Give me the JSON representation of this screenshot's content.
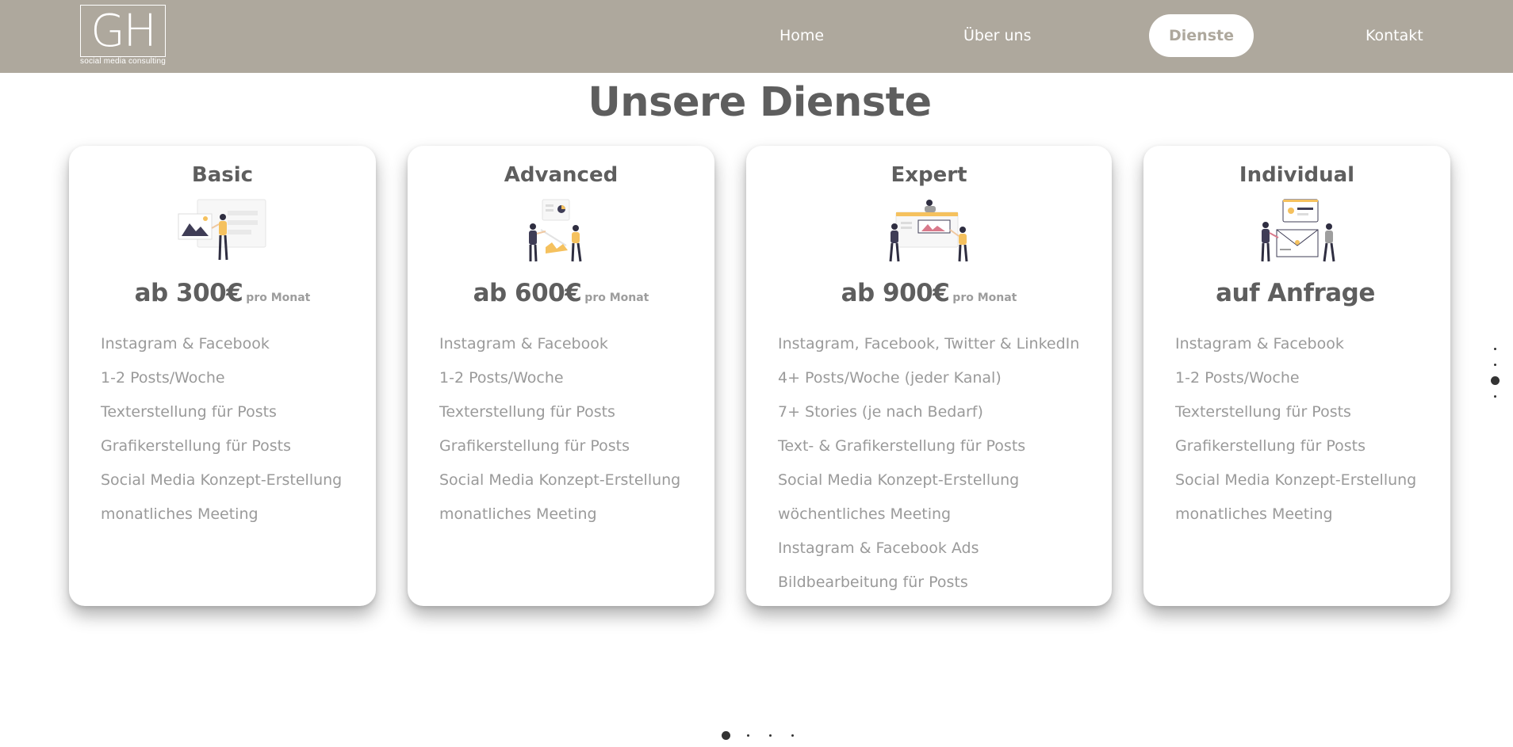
{
  "brand": {
    "logo_letters": "GH",
    "logo_subtitle": "social media consulting"
  },
  "nav": {
    "items": [
      {
        "label": "Home",
        "active": false
      },
      {
        "label": "Über uns",
        "active": false
      },
      {
        "label": "Dienste",
        "active": true
      },
      {
        "label": "Kontakt",
        "active": false
      }
    ]
  },
  "page": {
    "title": "Unsere Dienste"
  },
  "cards": [
    {
      "title": "Basic",
      "price": "ab 300€",
      "per": "pro Monat",
      "features": [
        "Instagram & Facebook",
        "1-2 Posts/Woche",
        "Texterstellung für Posts",
        "Grafikerstellung für Posts",
        "Social Media Konzept-Erstellung",
        "monatliches Meeting"
      ]
    },
    {
      "title": "Advanced",
      "price": "ab 600€",
      "per": "pro Monat",
      "features": [
        "Instagram & Facebook",
        "1-2 Posts/Woche",
        "Texterstellung für Posts",
        "Grafikerstellung für Posts",
        "Social Media Konzept-Erstellung",
        "monatliches Meeting"
      ]
    },
    {
      "title": "Expert",
      "price": "ab 900€",
      "per": "pro Monat",
      "features": [
        "Instagram, Facebook, Twitter & LinkedIn",
        "4+ Posts/Woche (jeder Kanal)",
        "7+ Stories (je nach Bedarf)",
        "Text- & Grafikerstellung für Posts",
        "Social Media Konzept-Erstellung",
        "wöchentliches Meeting",
        "Instagram & Facebook Ads",
        "Bildbearbeitung für Posts"
      ]
    },
    {
      "title": "Individual",
      "price": "auf Anfrage",
      "per": "",
      "features": [
        "Instagram & Facebook",
        "1-2 Posts/Woche",
        "Texterstellung für Posts",
        "Grafikerstellung für Posts",
        "Social Media Konzept-Erstellung",
        "monatliches Meeting"
      ]
    }
  ],
  "pagination": {
    "vertical_active_index": 2,
    "horizontal_active_index": 0
  },
  "colors": {
    "nav_bg": "#aea89d",
    "text_dark": "#5e5e5e",
    "text_light": "#9a9a9a",
    "accent_illustration": "#f5c15e",
    "dot": "#333333"
  },
  "icons": [
    "basic-illustration",
    "advanced-illustration",
    "expert-illustration",
    "individual-illustration"
  ]
}
